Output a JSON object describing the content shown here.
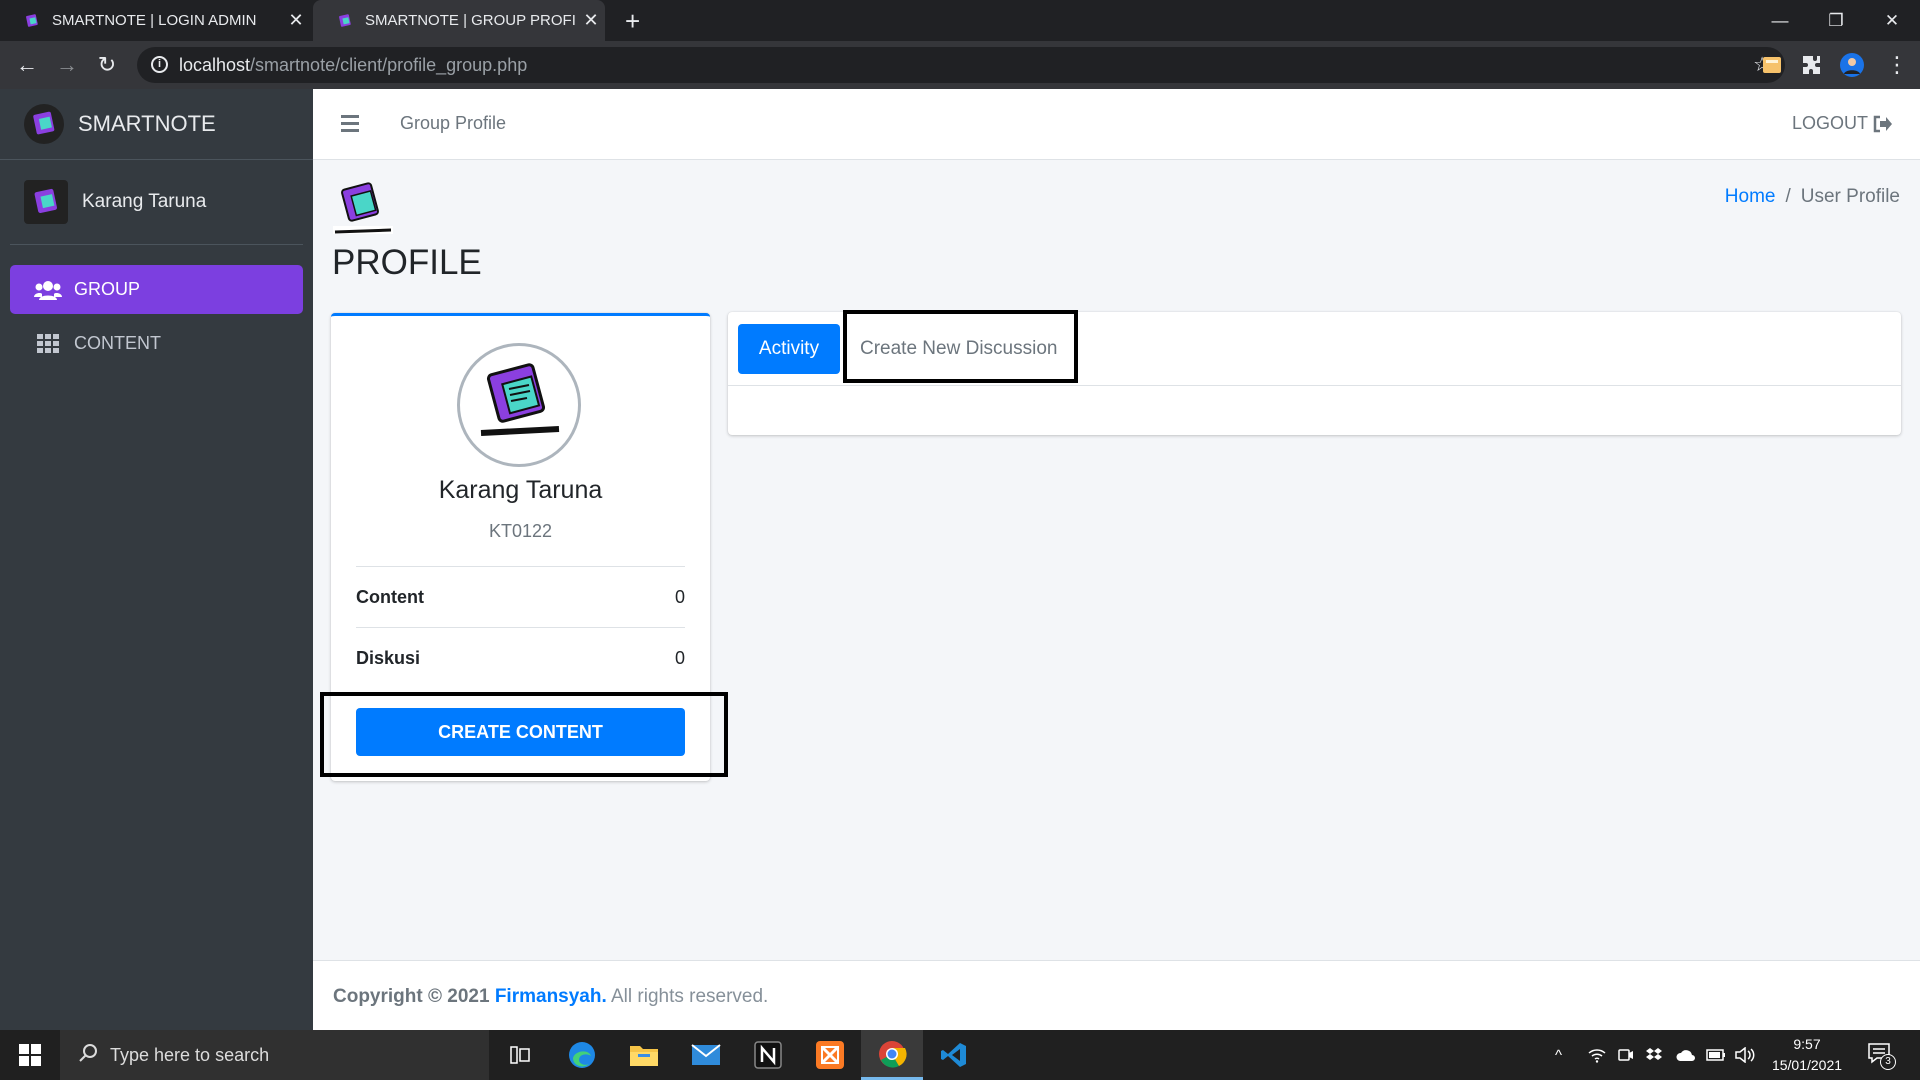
{
  "browser": {
    "tabs": [
      {
        "title": "SMARTNOTE | LOGIN ADMIN"
      },
      {
        "title": "SMARTNOTE | GROUP PROFILE"
      }
    ],
    "url_host": "localhost",
    "url_path": "/smartnote/client/profile_group.php"
  },
  "sidebar": {
    "brand": "SMARTNOTE",
    "user_name": "Karang Taruna",
    "items": [
      {
        "label": "GROUP",
        "active": true
      },
      {
        "label": "CONTENT",
        "active": false
      }
    ]
  },
  "topnav": {
    "page_link": "Group Profile",
    "logout": "LOGOUT"
  },
  "page": {
    "title": "PROFILE",
    "breadcrumb": {
      "home": "Home",
      "separator": "/",
      "current": "User Profile"
    }
  },
  "profile": {
    "name": "Karang Taruna",
    "code": "KT0122",
    "stats": [
      {
        "label": "Content",
        "value": "0"
      },
      {
        "label": "Diskusi",
        "value": "0"
      }
    ],
    "create_button": "CREATE CONTENT"
  },
  "tabs": {
    "activity": "Activity",
    "discussion": "Create New Discussion"
  },
  "footer": {
    "prefix": "Copyright © 2021",
    "author": "Firmansyah.",
    "suffix": "All rights reserved."
  },
  "taskbar": {
    "search_placeholder": "Type here to search",
    "time": "9:57",
    "date": "15/01/2021",
    "notifications": "3"
  },
  "colors": {
    "sidebar_bg": "#343a40",
    "active_nav": "#7c3fe0",
    "primary": "#007bff"
  }
}
